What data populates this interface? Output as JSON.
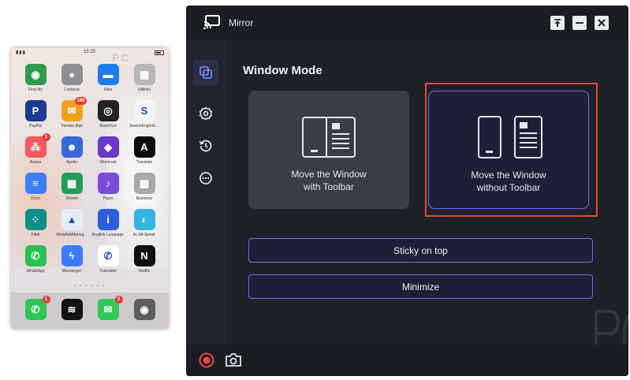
{
  "phone": {
    "time": "15:25",
    "watermark": "PC",
    "apps": [
      {
        "label": "Find My",
        "color": "#2e9b4e",
        "glyph": "◉",
        "badge": ""
      },
      {
        "label": "Contacts",
        "color": "#8f8f93",
        "glyph": "●",
        "badge": ""
      },
      {
        "label": "Files",
        "color": "#1d7cf2",
        "glyph": "▬",
        "badge": ""
      },
      {
        "label": "Utilities",
        "color": "#b7b5b8",
        "glyph": "▦",
        "badge": ""
      },
      {
        "label": "PayPal",
        "color": "#1b3b8f",
        "glyph": "P",
        "badge": ""
      },
      {
        "label": "Yandex Mail",
        "color": "#f0a21a",
        "glyph": "✉",
        "badge": "180"
      },
      {
        "label": "BlackVue",
        "color": "#222222",
        "glyph": "◎",
        "badge": ""
      },
      {
        "label": "SearchEngineL...",
        "color": "#f4f4f4",
        "glyph": "S",
        "badge": ""
      },
      {
        "label": "Asana",
        "color": "#f25a61",
        "glyph": "⁂",
        "badge": "1"
      },
      {
        "label": "Apollo",
        "color": "#3a67d8",
        "glyph": "☻",
        "badge": ""
      },
      {
        "label": "Shortcuts",
        "color": "#6b39c9",
        "glyph": "◆",
        "badge": ""
      },
      {
        "label": "Translate",
        "color": "#0d0d0d",
        "glyph": "A",
        "badge": ""
      },
      {
        "label": "Docs",
        "color": "#3d7ef2",
        "glyph": "≡",
        "badge": ""
      },
      {
        "label": "Sheets",
        "color": "#1f9e5a",
        "glyph": "▦",
        "badge": ""
      },
      {
        "label": "Piano",
        "color": "#7a4cd9",
        "glyph": "♪",
        "badge": ""
      },
      {
        "label": "Business",
        "color": "#a9a8ab",
        "glyph": "▦",
        "badge": ""
      },
      {
        "label": "Fitbit",
        "color": "#0e8e8b",
        "glyph": "⁘",
        "badge": ""
      },
      {
        "label": "MetaAdsManag...",
        "color": "#e4ecf7",
        "glyph": "▲",
        "badge": ""
      },
      {
        "label": "English Language",
        "color": "#2c5fd9",
        "glyph": "i",
        "badge": ""
      },
      {
        "label": "ELSA Speak",
        "color": "#32b6e0",
        "glyph": "◐",
        "badge": ""
      },
      {
        "label": "WhatsApp",
        "color": "#27c250",
        "glyph": "✆",
        "badge": ""
      },
      {
        "label": "Messenger",
        "color": "#3c79ff",
        "glyph": "ϟ",
        "badge": ""
      },
      {
        "label": "Truecaller",
        "color": "#ffffff",
        "glyph": "✆",
        "badge": ""
      },
      {
        "label": "Netflix",
        "color": "#101010",
        "glyph": "N",
        "badge": ""
      }
    ],
    "dock": [
      {
        "label": "Phone",
        "color": "#30c452",
        "glyph": "✆",
        "badge": "1"
      },
      {
        "label": "Spotify",
        "color": "#121212",
        "glyph": "≋",
        "badge": ""
      },
      {
        "label": "Messages",
        "color": "#33c759",
        "glyph": "✉",
        "badge": "3"
      },
      {
        "label": "Camera",
        "color": "#5d5d60",
        "glyph": "◉",
        "badge": ""
      }
    ]
  },
  "window": {
    "title": "Mirror",
    "section_title": "Window Mode",
    "card1": {
      "line1": "Move the Window",
      "line2": "with Toolbar"
    },
    "card2": {
      "line1": "Move the Window",
      "line2": "without Toolbar"
    },
    "sticky_label": "Sticky on top",
    "minimize_label": "Minimize",
    "accent": "#6b6ff0",
    "highlight": "#e8453c"
  },
  "icons": {
    "cast": "screen-mirror-icon",
    "pin": "pin-icon",
    "minimize": "minimize-icon",
    "close": "close-icon",
    "window_mode": "window-mode-icon",
    "settings": "gear-icon",
    "history": "history-icon",
    "more": "more-icon",
    "record": "record-icon",
    "screenshot": "camera-icon"
  }
}
